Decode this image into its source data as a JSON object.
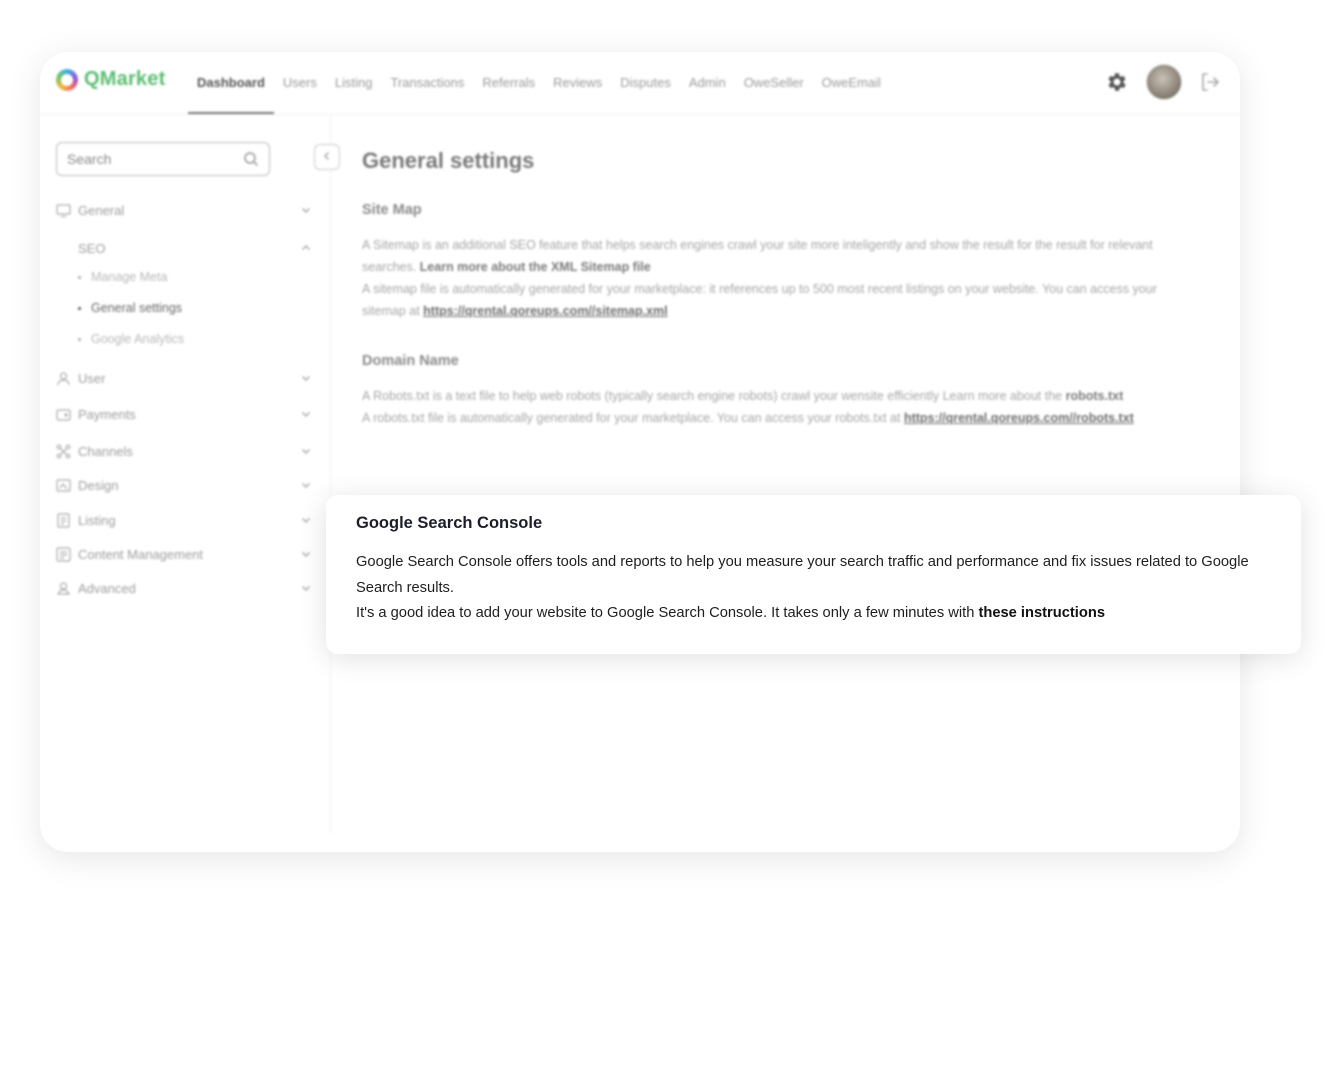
{
  "header": {
    "brand": "QMarket",
    "nav": [
      "Dashboard",
      "Users",
      "Listing",
      "Transactions",
      "Referrals",
      "Reviews",
      "Disputes",
      "Admin",
      "OweSeller",
      "OweEmail"
    ],
    "active_nav": "Dashboard"
  },
  "sidebar": {
    "search_placeholder": "Search",
    "items": [
      {
        "label": "General",
        "icon": "monitor-icon"
      },
      {
        "label": "User",
        "icon": "user-icon"
      },
      {
        "label": "Payments",
        "icon": "wallet-icon"
      },
      {
        "label": "Channels",
        "icon": "channels-icon"
      },
      {
        "label": "Design",
        "icon": "design-icon"
      },
      {
        "label": "Listing",
        "icon": "list-icon"
      },
      {
        "label": "Content Management",
        "icon": "content-icon"
      },
      {
        "label": "Advanced",
        "icon": "advanced-icon"
      }
    ],
    "seo": {
      "label": "SEO",
      "children": [
        "Manage Meta",
        "General settings",
        "Google Analytics"
      ],
      "active": "General settings"
    }
  },
  "content": {
    "title": "General settings",
    "site_map": {
      "heading": "Site Map",
      "line1": "A Sitemap is an additional SEO feature that helps search engines crawl your site more inteligently and show the result for the result for relevant searches. ",
      "link1": "Learn more about the XML Sitemap file",
      "line2": "A sitemap file is automatically generated for your marketplace: it references up to 500 most recent listings on your website. You can access your sitemap at ",
      "link2": "https://qrental.qoreups.com//sitemap.xml"
    },
    "domain": {
      "heading": "Domain Name",
      "line1": "A Robots.txt is a text file to help web robots (typically search engine robots) crawl your wensite efficiently Learn more about the ",
      "bold1": "robots.txt",
      "line2": "A robots.txt file is automatically generated for your marketplace. You can access your robots.txt at ",
      "link2": "https://qrental.qoreups.com//robots.txt"
    }
  },
  "card": {
    "title": "Google Search Console",
    "line1": "Google Search Console offers tools and reports to help you measure your search traffic and performance and fix issues related to Google Search results.",
    "line2": "It's a good idea to add your website to Google Search Console. It takes only a few minutes with ",
    "link": "these instructions"
  }
}
